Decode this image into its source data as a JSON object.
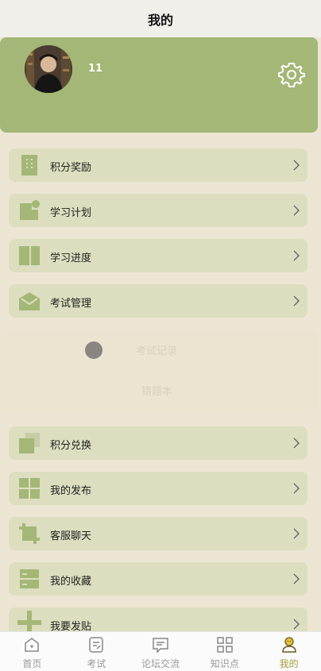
{
  "header": {
    "title": "我的"
  },
  "profile": {
    "username": "11"
  },
  "menu": {
    "items": [
      {
        "label": "积分奖励",
        "icon": "building-icon"
      },
      {
        "label": "学习计划",
        "icon": "calendar-note-icon"
      },
      {
        "label": "学习进度",
        "icon": "book-icon"
      },
      {
        "label": "考试管理",
        "icon": "envelope-icon"
      },
      {
        "label": "积分兑换",
        "icon": "copy-icon"
      },
      {
        "label": "我的发布",
        "icon": "grid-icon"
      },
      {
        "label": "客服聊天",
        "icon": "crop-icon"
      },
      {
        "label": "我的收藏",
        "icon": "drawer-icon"
      },
      {
        "label": "我要发贴",
        "icon": "plus-icon"
      }
    ]
  },
  "exam_submenu": {
    "items": [
      "考试记录",
      "错题本"
    ]
  },
  "tabbar": {
    "items": [
      {
        "label": "首页",
        "icon": "home-icon"
      },
      {
        "label": "考试",
        "icon": "exam-icon"
      },
      {
        "label": "论坛交流",
        "icon": "chat-icon"
      },
      {
        "label": "知识点",
        "icon": "grid-icon"
      },
      {
        "label": "我的",
        "icon": "user-icon"
      }
    ],
    "active_index": 4
  },
  "colors": {
    "accent": "#a4b776",
    "menu_bg": "#dcdebf",
    "page_bg": "#ede5d4",
    "active_tab": "#a59a3a"
  }
}
